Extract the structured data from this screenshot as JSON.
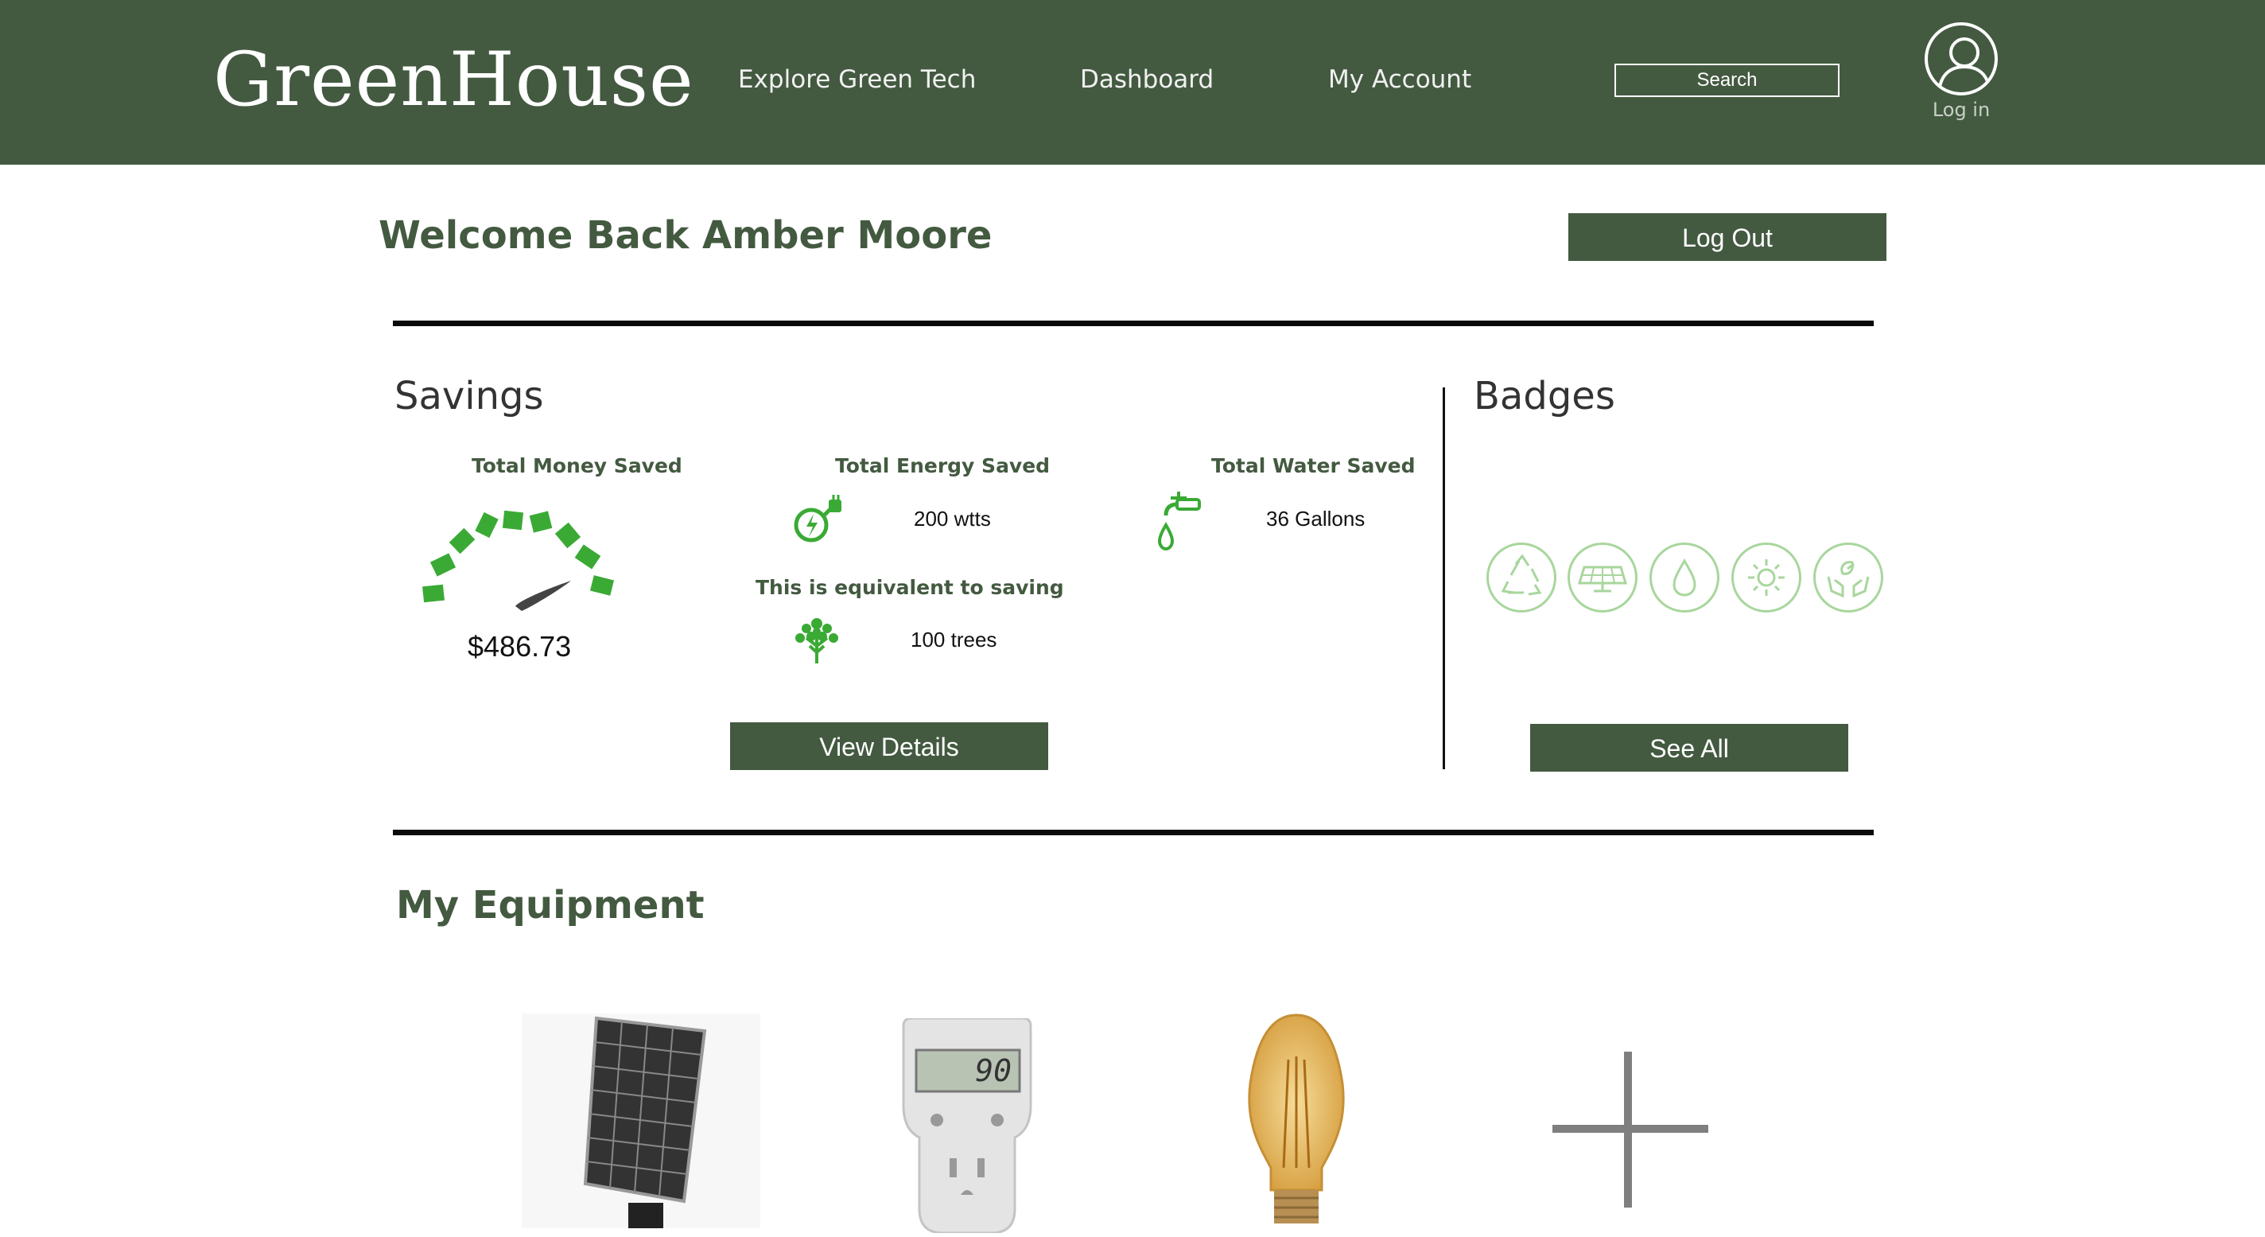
{
  "header": {
    "brand": "GreenHouse",
    "nav": [
      {
        "label": "Explore Green Tech"
      },
      {
        "label": "Dashboard"
      },
      {
        "label": "My Account"
      }
    ],
    "search_label": "Search",
    "login_label": "Log in"
  },
  "welcome": {
    "title": "Welcome Back Amber Moore",
    "logout_label": "Log Out"
  },
  "savings": {
    "title": "Savings",
    "money": {
      "label": "Total Money Saved",
      "value": "$486.73"
    },
    "energy": {
      "label": "Total Energy Saved",
      "value": "200 wtts"
    },
    "water": {
      "label": "Total Water Saved",
      "value": "36 Gallons"
    },
    "equivalent": {
      "label": "This is equivalent to saving",
      "value": "100 trees"
    },
    "details_label": "View Details"
  },
  "badges": {
    "title": "Badges",
    "items": [
      {
        "icon": "recycle-icon"
      },
      {
        "icon": "solar-panel-icon"
      },
      {
        "icon": "water-drop-icon"
      },
      {
        "icon": "sun-icon"
      },
      {
        "icon": "hands-leaf-icon"
      }
    ],
    "see_all_label": "See All"
  },
  "equipment": {
    "title": "My Equipment",
    "items": [
      {
        "icon": "solar-panel-image"
      },
      {
        "icon": "power-meter-image",
        "display": "90"
      },
      {
        "icon": "light-bulb-image"
      },
      {
        "icon": "add-equipment-icon"
      }
    ]
  },
  "colors": {
    "brand_green": "#435a40",
    "accent_green": "#3aaa35",
    "badge_green": "#a8d69c"
  }
}
